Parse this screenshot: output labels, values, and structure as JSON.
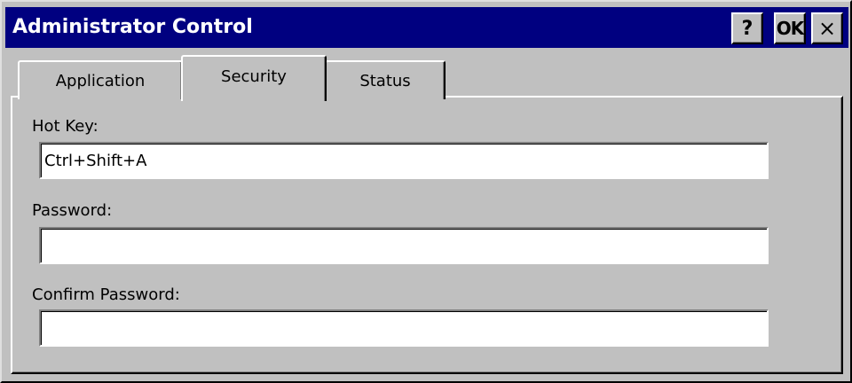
{
  "window": {
    "title": "Administrator Control",
    "help_label": "?",
    "ok_label": "OK",
    "close_label": "×"
  },
  "tabs": [
    {
      "label": "Application",
      "selected": false
    },
    {
      "label": "Security",
      "selected": true
    },
    {
      "label": "Status",
      "selected": false
    }
  ],
  "form": {
    "hotkey_label": "Hot Key:",
    "hotkey_value": "Ctrl+Shift+A",
    "password_label": "Password:",
    "password_value": "",
    "confirm_label": "Confirm Password:",
    "confirm_value": ""
  },
  "colors": {
    "titlebar": "#000080",
    "face": "#c0c0c0"
  }
}
